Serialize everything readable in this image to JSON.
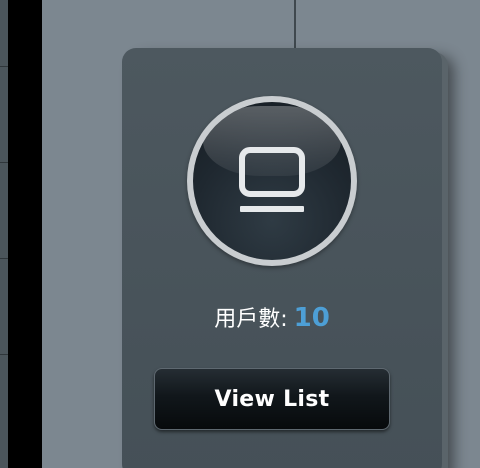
{
  "clients_card": {
    "icon": "monitor-icon",
    "count_label": "用戶數:",
    "count_value": "10",
    "view_list_label": "View List"
  },
  "colors": {
    "count_value": "#4d9fd6",
    "card_background": "#4b565d",
    "page_background": "#7c8790",
    "button_background": "#0c1114"
  }
}
